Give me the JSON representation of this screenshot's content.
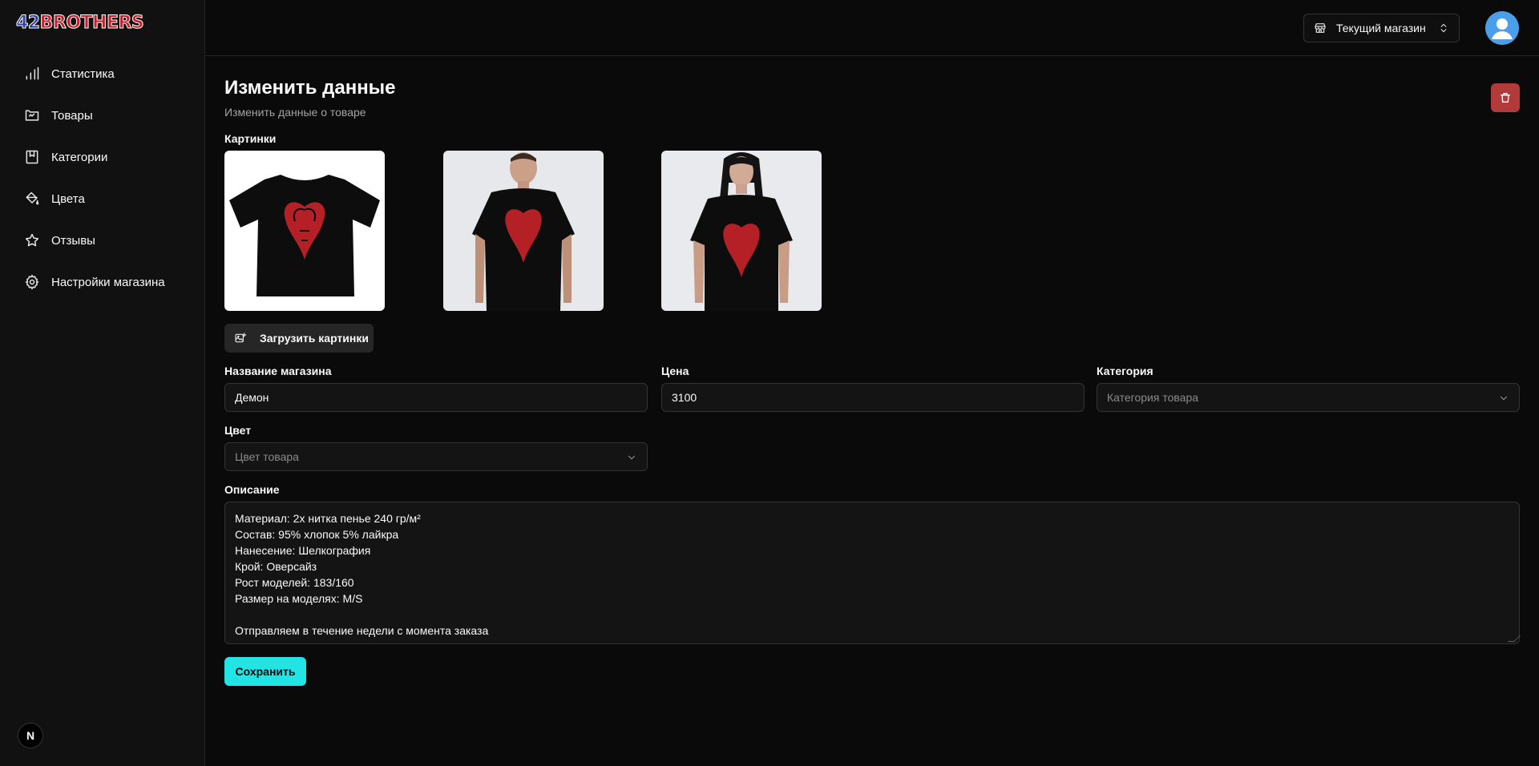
{
  "brand": {
    "logo_num": "42",
    "logo_word": "BROTHERS",
    "next_badge": "N"
  },
  "sidebar": {
    "items": [
      {
        "label": "Статистика",
        "icon": "bar-chart-icon"
      },
      {
        "label": "Товары",
        "icon": "product-frame-icon"
      },
      {
        "label": "Категории",
        "icon": "bookmark-icon"
      },
      {
        "label": "Цвета",
        "icon": "paint-bucket-icon"
      },
      {
        "label": "Отзывы",
        "icon": "star-icon"
      },
      {
        "label": "Настройки магазина",
        "icon": "gear-icon"
      }
    ]
  },
  "header": {
    "store_switcher": "Текущий магазин"
  },
  "page": {
    "title": "Изменить данные",
    "subtitle": "Изменить данные о товаре"
  },
  "form": {
    "images_label": "Картинки",
    "upload_label": "Загрузить картинки",
    "name_label": "Название магазина",
    "name_value": "Демон",
    "price_label": "Цена",
    "price_value": "3100",
    "category_label": "Категория",
    "category_placeholder": "Категория товара",
    "color_label": "Цвет",
    "color_placeholder": "Цвет товара",
    "description_label": "Описание",
    "description_lines": [
      "Материал: 2х нитка пенье 240 гр/м²",
      "Состав: 95% хлопок 5% лайкра",
      "Нанесение: Шелкография",
      "Крой: Оверсайз",
      "Рост моделей: 183/160",
      "Размер на моделях: M/S",
      "",
      "Отправляем в течение недели с момента заказа"
    ],
    "save_label": "Сохранить"
  },
  "colors": {
    "accent": "#22e4e4",
    "danger": "#b23a3a",
    "background": "#0a0a0a",
    "sidebar": "#111111"
  }
}
